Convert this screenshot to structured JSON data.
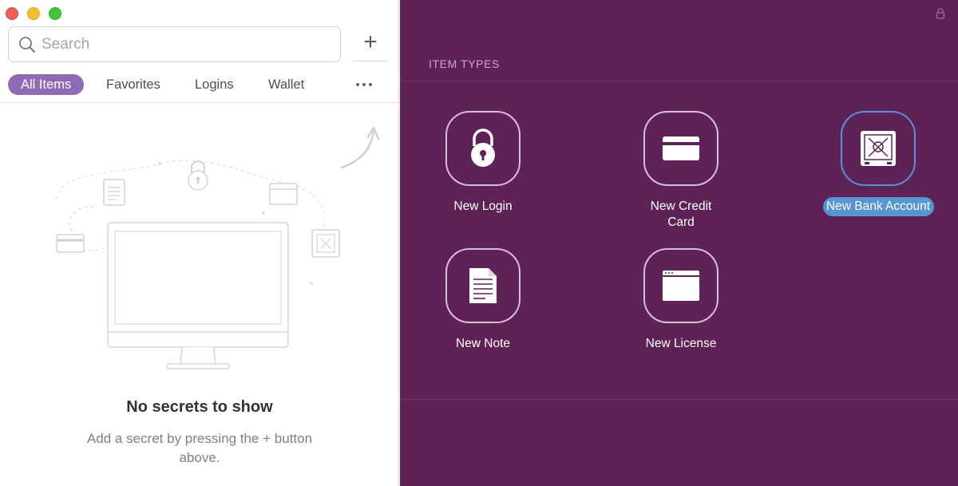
{
  "window": {
    "controls": [
      "close",
      "minimize",
      "zoom"
    ]
  },
  "search": {
    "placeholder": "Search",
    "value": ""
  },
  "toolbar": {
    "add_label": "+"
  },
  "tabs": [
    {
      "label": "All Items",
      "active": true
    },
    {
      "label": "Favorites",
      "active": false
    },
    {
      "label": "Logins",
      "active": false
    },
    {
      "label": "Wallet",
      "active": false
    }
  ],
  "empty_state": {
    "title": "No secrets to show",
    "subtitle": "Add a secret by pressing the + button above."
  },
  "item_types": {
    "section_title": "ITEM TYPES",
    "items": [
      {
        "label": "New Login",
        "icon": "padlock-icon",
        "selected": false
      },
      {
        "label": "New Credit Card",
        "icon": "credit-card-icon",
        "selected": false
      },
      {
        "label": "New Bank Account",
        "icon": "safe-icon",
        "selected": true
      },
      {
        "label": "New Note",
        "icon": "note-icon",
        "selected": false
      },
      {
        "label": "New License",
        "icon": "license-window-icon",
        "selected": false
      }
    ]
  },
  "colors": {
    "accent_tab": "#8e6bb5",
    "right_panel_bg": "#5f2257",
    "selected_label_bg": "#5696d2",
    "selected_border": "#5b8fd6"
  }
}
